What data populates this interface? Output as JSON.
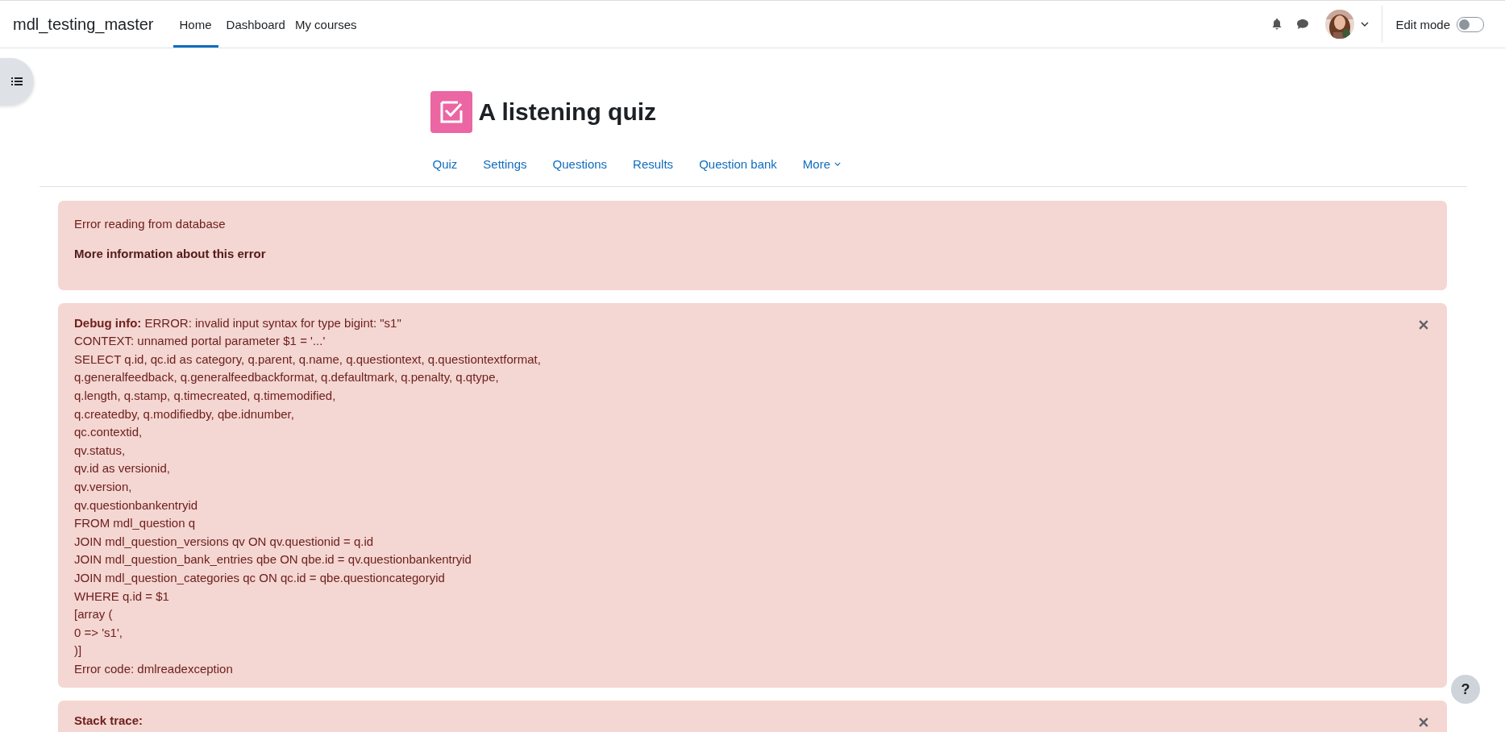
{
  "navbar": {
    "brand": "mdl_testing_master",
    "nav_items": [
      {
        "label": "Home",
        "selected": true
      },
      {
        "label": "Dashboard",
        "selected": false
      },
      {
        "label": "My courses",
        "selected": false
      }
    ],
    "edit_mode": {
      "label": "Edit mode",
      "on": false
    }
  },
  "page": {
    "title": "A listening quiz",
    "tabs": [
      {
        "label": "Quiz",
        "kind": "link"
      },
      {
        "label": "Settings",
        "kind": "link"
      },
      {
        "label": "Questions",
        "kind": "link"
      },
      {
        "label": "Results",
        "kind": "link"
      },
      {
        "label": "Question bank",
        "kind": "link"
      },
      {
        "label": "More",
        "kind": "menu"
      }
    ]
  },
  "alerts": [
    {
      "kind": "error",
      "closable": false,
      "lines": [
        "Error reading from database"
      ],
      "link": "More information about this error"
    },
    {
      "kind": "debug",
      "closable": true,
      "lines": [
        "**Debug info:** ERROR: invalid input syntax for type bigint: \"s1\"",
        "CONTEXT: unnamed portal parameter $1 = '...'",
        "SELECT q.id, qc.id as category, q.parent, q.name, q.questiontext, q.questiontextformat,",
        "q.generalfeedback, q.generalfeedbackformat, q.defaultmark, q.penalty, q.qtype,",
        "q.length, q.stamp, q.timecreated, q.timemodified,",
        "q.createdby, q.modifiedby, qbe.idnumber,",
        "qc.contextid,",
        "qv.status,",
        "qv.id as versionid,",
        "qv.version,",
        "qv.questionbankentryid",
        "FROM mdl_question q",
        "JOIN mdl_question_versions qv ON qv.questionid = q.id",
        "JOIN mdl_question_bank_entries qbe ON qbe.id = qv.questionbankentryid",
        "JOIN mdl_question_categories qc ON qc.id = qbe.questioncategoryid",
        "WHERE q.id = $1",
        "[array (",
        "0 => 's1',",
        ")]",
        "Error code: dmlreadexception"
      ]
    },
    {
      "kind": "debug",
      "closable": true,
      "lines": [
        "**Stack trace:**"
      ]
    }
  ],
  "help_button": {
    "label": "?"
  }
}
